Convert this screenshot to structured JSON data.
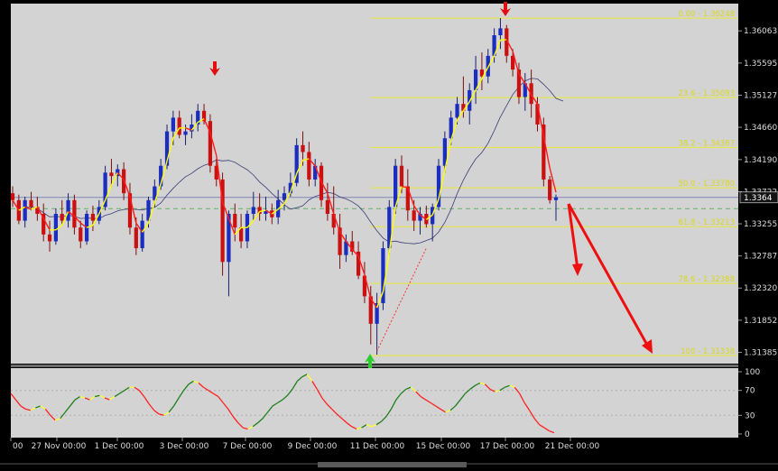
{
  "chart_data": [
    {
      "type": "candlestick",
      "symbol_price_label": "1.3364",
      "y_tick_labels": [
        "1.36063",
        "1.35595",
        "1.35127",
        "1.34660",
        "1.34190",
        "1.33722",
        "1.33255",
        "1.32787",
        "1.32320",
        "1.31852",
        "1.31385"
      ],
      "y_ticks": [
        1.36063,
        1.35595,
        1.35127,
        1.3466,
        1.3419,
        1.33722,
        1.33255,
        1.32787,
        1.3232,
        1.31852,
        1.31385
      ],
      "ylim": [
        1.3122,
        1.3646
      ],
      "x_tick_labels": [
        "00",
        "27 Nov 00:00",
        "1 Dec 00:00",
        "3 Dec 00:00",
        "7 Dec 00:00",
        "9 Dec 00:00",
        "11 Dec 00:00",
        "15 Dec 00:00",
        "17 Dec 00:00",
        "21 Dec 00:00"
      ],
      "current_price": 1.3364,
      "fibonacci_levels": [
        {
          "label": "0.00 - 1.36248",
          "value": 1.36248
        },
        {
          "label": "23.6 - 1.35093",
          "value": 1.35093
        },
        {
          "label": "38.2 - 1.34367",
          "value": 1.34367
        },
        {
          "label": "50.0 - 1.33780",
          "value": 1.3378
        },
        {
          "label": "61.8 - 1.33213",
          "value": 1.33213
        },
        {
          "label": "78.6 - 1.32388",
          "value": 1.32388
        },
        {
          "label": "100 - 1.31338",
          "value": 1.31338
        }
      ],
      "candles": [
        [
          1.337,
          1.338,
          1.335,
          1.336
        ],
        [
          1.336,
          1.3368,
          1.3325,
          1.333
        ],
        [
          1.333,
          1.3365,
          1.332,
          1.336
        ],
        [
          1.336,
          1.3372,
          1.3345,
          1.335
        ],
        [
          1.335,
          1.3365,
          1.333,
          1.334
        ],
        [
          1.334,
          1.3355,
          1.33,
          1.331
        ],
        [
          1.331,
          1.333,
          1.3285,
          1.33
        ],
        [
          1.33,
          1.3348,
          1.3295,
          1.334
        ],
        [
          1.334,
          1.336,
          1.3325,
          1.333
        ],
        [
          1.333,
          1.337,
          1.332,
          1.336
        ],
        [
          1.336,
          1.3368,
          1.331,
          1.332
        ],
        [
          1.332,
          1.333,
          1.329,
          1.33
        ],
        [
          1.33,
          1.3345,
          1.3295,
          1.334
        ],
        [
          1.334,
          1.3352,
          1.3315,
          1.333
        ],
        [
          1.333,
          1.336,
          1.3325,
          1.335
        ],
        [
          1.335,
          1.341,
          1.3345,
          1.34
        ],
        [
          1.34,
          1.342,
          1.338,
          1.3395
        ],
        [
          1.3395,
          1.3412,
          1.338,
          1.3405
        ],
        [
          1.3405,
          1.3415,
          1.336,
          1.337
        ],
        [
          1.337,
          1.3385,
          1.331,
          1.332
        ],
        [
          1.332,
          1.3335,
          1.328,
          1.329
        ],
        [
          1.329,
          1.334,
          1.3285,
          1.333
        ],
        [
          1.333,
          1.3365,
          1.332,
          1.336
        ],
        [
          1.336,
          1.339,
          1.335,
          1.338
        ],
        [
          1.338,
          1.342,
          1.3375,
          1.341
        ],
        [
          1.341,
          1.347,
          1.3405,
          1.346
        ],
        [
          1.346,
          1.349,
          1.344,
          1.348
        ],
        [
          1.348,
          1.349,
          1.345,
          1.3455
        ],
        [
          1.3455,
          1.347,
          1.344,
          1.346
        ],
        [
          1.346,
          1.3485,
          1.345,
          1.347
        ],
        [
          1.347,
          1.35,
          1.346,
          1.349
        ],
        [
          1.349,
          1.35,
          1.347,
          1.3475
        ],
        [
          1.3475,
          1.3485,
          1.34,
          1.341
        ],
        [
          1.341,
          1.342,
          1.338,
          1.339
        ],
        [
          1.339,
          1.34,
          1.325,
          1.327
        ],
        [
          1.327,
          1.3345,
          1.322,
          1.334
        ],
        [
          1.334,
          1.3355,
          1.33,
          1.332
        ],
        [
          1.332,
          1.334,
          1.329,
          1.33
        ],
        [
          1.33,
          1.3345,
          1.329,
          1.334
        ],
        [
          1.334,
          1.3372,
          1.333,
          1.335
        ],
        [
          1.335,
          1.337,
          1.333,
          1.334
        ],
        [
          1.334,
          1.3365,
          1.333,
          1.3345
        ],
        [
          1.3345,
          1.3355,
          1.3325,
          1.3335
        ],
        [
          1.3335,
          1.3375,
          1.3325,
          1.336
        ],
        [
          1.336,
          1.338,
          1.3345,
          1.337
        ],
        [
          1.337,
          1.34,
          1.3365,
          1.3385
        ],
        [
          1.3385,
          1.345,
          1.338,
          1.344
        ],
        [
          1.344,
          1.346,
          1.341,
          1.343
        ],
        [
          1.343,
          1.3445,
          1.338,
          1.339
        ],
        [
          1.339,
          1.342,
          1.338,
          1.341
        ],
        [
          1.341,
          1.3415,
          1.335,
          1.336
        ],
        [
          1.336,
          1.3385,
          1.333,
          1.334
        ],
        [
          1.334,
          1.338,
          1.331,
          1.332
        ],
        [
          1.332,
          1.334,
          1.326,
          1.328
        ],
        [
          1.328,
          1.331,
          1.327,
          1.33
        ],
        [
          1.33,
          1.3315,
          1.328,
          1.3285
        ],
        [
          1.3285,
          1.33,
          1.3245,
          1.325
        ],
        [
          1.325,
          1.327,
          1.321,
          1.322
        ],
        [
          1.322,
          1.3235,
          1.315,
          1.318
        ],
        [
          1.318,
          1.3225,
          1.3135,
          1.321
        ],
        [
          1.321,
          1.33,
          1.32,
          1.329
        ],
        [
          1.329,
          1.336,
          1.328,
          1.335
        ],
        [
          1.335,
          1.342,
          1.334,
          1.341
        ],
        [
          1.341,
          1.3425,
          1.337,
          1.338
        ],
        [
          1.338,
          1.3405,
          1.333,
          1.3345
        ],
        [
          1.3345,
          1.336,
          1.3315,
          1.333
        ],
        [
          1.333,
          1.335,
          1.331,
          1.334
        ],
        [
          1.334,
          1.3352,
          1.332,
          1.3325
        ],
        [
          1.3325,
          1.3355,
          1.33,
          1.335
        ],
        [
          1.335,
          1.342,
          1.3345,
          1.341
        ],
        [
          1.341,
          1.346,
          1.34,
          1.345
        ],
        [
          1.345,
          1.349,
          1.344,
          1.348
        ],
        [
          1.348,
          1.351,
          1.347,
          1.35
        ],
        [
          1.35,
          1.354,
          1.348,
          1.349
        ],
        [
          1.349,
          1.353,
          1.347,
          1.352
        ],
        [
          1.352,
          1.357,
          1.35,
          1.355
        ],
        [
          1.355,
          1.3575,
          1.352,
          1.354
        ],
        [
          1.354,
          1.358,
          1.353,
          1.357
        ],
        [
          1.357,
          1.361,
          1.356,
          1.36
        ],
        [
          1.36,
          1.3625,
          1.358,
          1.361
        ],
        [
          1.361,
          1.3615,
          1.356,
          1.357
        ],
        [
          1.357,
          1.358,
          1.354,
          1.355
        ],
        [
          1.355,
          1.356,
          1.35,
          1.351
        ],
        [
          1.351,
          1.3545,
          1.349,
          1.353
        ],
        [
          1.353,
          1.355,
          1.348,
          1.35
        ],
        [
          1.35,
          1.351,
          1.346,
          1.347
        ],
        [
          1.347,
          1.348,
          1.338,
          1.339
        ],
        [
          1.339,
          1.3395,
          1.3355,
          1.336
        ],
        [
          1.336,
          1.3368,
          1.333,
          1.3364
        ]
      ],
      "indicator": {
        "y_tick_labels": [
          "100",
          "70",
          "30",
          "0"
        ],
        "y_ticks": [
          100,
          70,
          30,
          0
        ],
        "levels": [
          70,
          30
        ],
        "ylim": [
          0,
          100
        ],
        "values": [
          65,
          55,
          45,
          40,
          38,
          42,
          45,
          40,
          30,
          22,
          25,
          35,
          45,
          55,
          60,
          58,
          55,
          60,
          62,
          58,
          55,
          60,
          65,
          70,
          75,
          75,
          70,
          60,
          48,
          38,
          32,
          30,
          35,
          45,
          58,
          70,
          80,
          85,
          82,
          75,
          70,
          65,
          60,
          50,
          40,
          28,
          18,
          10,
          8,
          12,
          18,
          25,
          35,
          45,
          50,
          55,
          62,
          72,
          85,
          92,
          96,
          85,
          72,
          58,
          48,
          40,
          32,
          25,
          18,
          12,
          8,
          10,
          15,
          12,
          15,
          20,
          28,
          40,
          55,
          65,
          72,
          75,
          68,
          60,
          55,
          50,
          45,
          40,
          35,
          38,
          45,
          55,
          65,
          72,
          78,
          82,
          80,
          72,
          68,
          70,
          75,
          78,
          75,
          65,
          50,
          38,
          25,
          15,
          10,
          5,
          2
        ]
      }
    }
  ]
}
